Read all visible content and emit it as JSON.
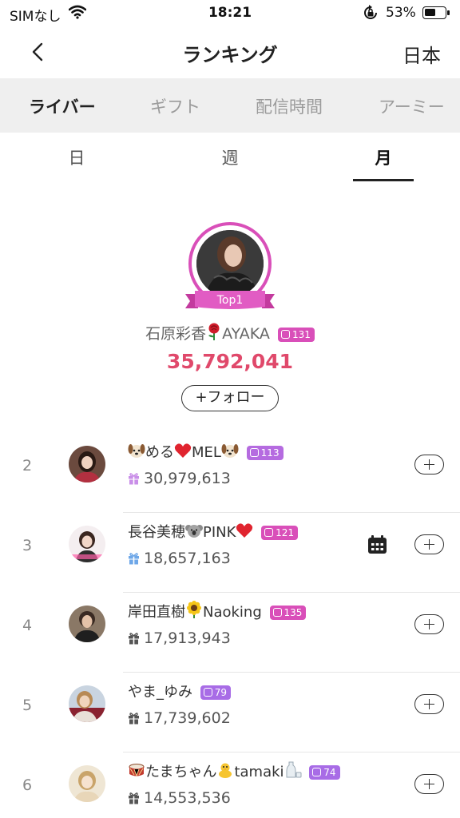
{
  "status_bar": {
    "carrier": "SIMなし",
    "time": "18:21",
    "battery_percent": "53%",
    "battery_level": 0.53
  },
  "nav": {
    "title": "ランキング",
    "region": "日本"
  },
  "category_tabs": [
    {
      "label": "ライバー",
      "active": true
    },
    {
      "label": "ギフト",
      "active": false
    },
    {
      "label": "配信時間",
      "active": false
    },
    {
      "label": "アーミー",
      "active": false
    }
  ],
  "period_tabs": [
    {
      "label": "日",
      "active": false
    },
    {
      "label": "週",
      "active": false
    },
    {
      "label": "月",
      "active": true
    }
  ],
  "top1": {
    "ribbon": "Top1",
    "name_before": "石原彩香",
    "name_after": "AYAKA",
    "emoji": "rose-icon",
    "level": "131",
    "level_color": "#d94fb9",
    "score": "35,792,041",
    "follow_label": "+フォロー"
  },
  "list": [
    {
      "rank": "2",
      "name_parts": [
        "",
        "める",
        "MEL",
        ""
      ],
      "level": "113",
      "level_color": "#b56be0",
      "score": "30,979,613",
      "gift_color": "#c98fe8"
    },
    {
      "rank": "3",
      "name_parts": [
        "長谷美穂",
        "PINK"
      ],
      "level": "121",
      "level_color": "#d94fb9",
      "score": "18,657,163",
      "gift_color": "#6ea7e8"
    },
    {
      "rank": "4",
      "name_parts": [
        "岸田直樹",
        "Naoking"
      ],
      "level": "135",
      "level_color": "#d94fb9",
      "score": "17,913,943",
      "gift_color": "#555555"
    },
    {
      "rank": "5",
      "name_parts": [
        "やま_ゆみ"
      ],
      "level": "79",
      "level_color": "#a86ce6",
      "score": "17,739,602",
      "gift_color": "#555555"
    },
    {
      "rank": "6",
      "name_parts": [
        "",
        "たまちゃん",
        "tamaki",
        ""
      ],
      "level": "74",
      "level_color": "#a86ce6",
      "score": "14,553,536",
      "gift_color": "#555555"
    }
  ],
  "icons": {
    "back": "chevron-left-icon",
    "wifi": "wifi-icon",
    "lock": "rotation-lock-icon",
    "battery": "battery-icon",
    "calendar": "calendar-icon",
    "gift": "gift-icon",
    "add": "plus-icon",
    "dog": "dog-face-icon",
    "heart": "red-heart-icon",
    "koala": "koala-icon",
    "sunflower": "sunflower-icon",
    "drum": "drum-icon",
    "chick": "hatching-chick-icon",
    "sake": "sake-icon"
  }
}
